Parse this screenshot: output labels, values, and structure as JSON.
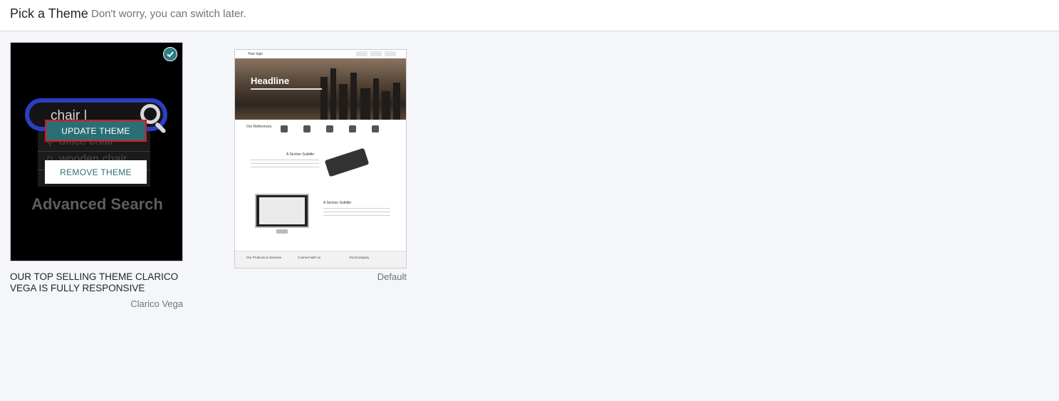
{
  "header": {
    "title": "Pick a Theme",
    "subtitle": "Don't worry, you can switch later."
  },
  "themes": [
    {
      "preview": {
        "search_text": "chair |",
        "suggestions": [
          "office chair",
          "wooden chair"
        ],
        "caption_text": "Advanced Search"
      },
      "update_label": "UPDATE THEME",
      "remove_label": "REMOVE THEME",
      "installed_icon": "check-circle-icon",
      "description": "OUR TOP SELLING THEME CLARICO VEGA IS FULLY RESPONSIVE",
      "name": "Clarico Vega"
    },
    {
      "preview": {
        "logo": "Your logo",
        "headline": "Headline",
        "references": "Our References",
        "section1": "A Section Subtitle",
        "section2": "A Section Subtitle",
        "footer_col1": "Our Products & Services",
        "footer_col2": "Connect with us",
        "footer_col3": "YourCompany"
      },
      "name": "Default"
    }
  ],
  "colors": {
    "accent": "#2b6f74",
    "highlight_border": "#e0141c",
    "background": "#f5f6fa"
  }
}
